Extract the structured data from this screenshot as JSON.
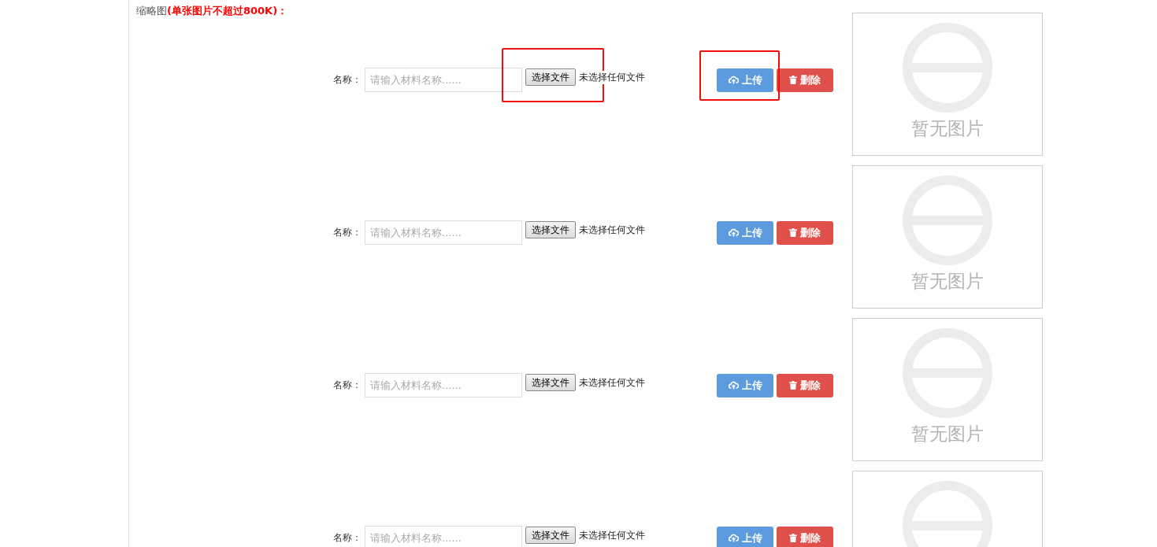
{
  "header": {
    "label": "缩略图",
    "note": "(单张图片不超过800K)："
  },
  "rows": [
    {
      "name_label": "名称：",
      "name_placeholder": "请输入材料名称......",
      "file_button": "选择文件",
      "file_status": "未选择任何文件",
      "upload_button": "上传",
      "delete_button": "删除",
      "image_text": "暂无图片",
      "file_highlighted": true,
      "upload_highlighted": true
    },
    {
      "name_label": "名称：",
      "name_placeholder": "请输入材料名称......",
      "file_button": "选择文件",
      "file_status": "未选择任何文件",
      "upload_button": "上传",
      "delete_button": "删除",
      "image_text": "暂无图片",
      "file_highlighted": false,
      "upload_highlighted": false
    },
    {
      "name_label": "名称：",
      "name_placeholder": "请输入材料名称......",
      "file_button": "选择文件",
      "file_status": "未选择任何文件",
      "upload_button": "上传",
      "delete_button": "删除",
      "image_text": "暂无图片",
      "file_highlighted": false,
      "upload_highlighted": false
    },
    {
      "name_label": "名称：",
      "name_placeholder": "请输入材料名称......",
      "file_button": "选择文件",
      "file_status": "未选择任何文件",
      "upload_button": "上传",
      "delete_button": "删除",
      "file_highlighted": false,
      "upload_highlighted": false
    }
  ]
}
